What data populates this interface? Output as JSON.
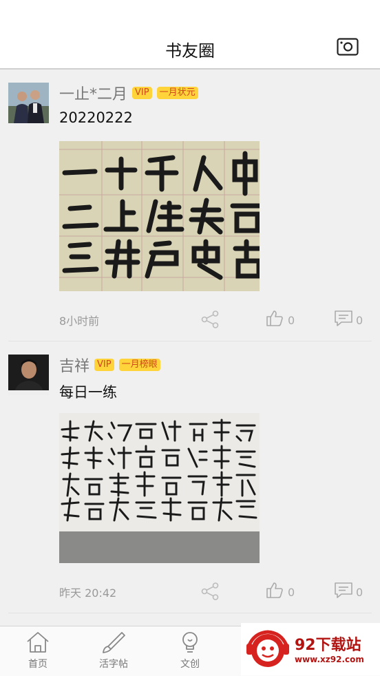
{
  "header": {
    "title": "书友圈"
  },
  "icons": {
    "camera": "camera-icon",
    "share": "share-icon",
    "like": "thumbs-up-icon",
    "comment": "comment-icon",
    "home": "home-icon",
    "brush": "brush-icon",
    "bulb": "lightbulb-icon"
  },
  "posts": [
    {
      "author": "一止*二月",
      "vip": "VIP",
      "rank": "一月状元",
      "text": "20220222",
      "time": "8小时前",
      "likes": "0",
      "comments": "0"
    },
    {
      "author": "吉祥",
      "vip": "VIP",
      "rank": "一月榜眼",
      "text": "每日一练",
      "time": "昨天  20:42",
      "likes": "0",
      "comments": "0"
    }
  ],
  "tabbar": {
    "home": "首页",
    "copybook": "活字帖",
    "creative": "文创"
  },
  "watermark": {
    "title": "92下载站",
    "url": "www.xz92.com"
  },
  "colors": {
    "badge_bg": "#ffd43b",
    "badge_text": "#d0471a",
    "watermark_red": "#b21412"
  }
}
